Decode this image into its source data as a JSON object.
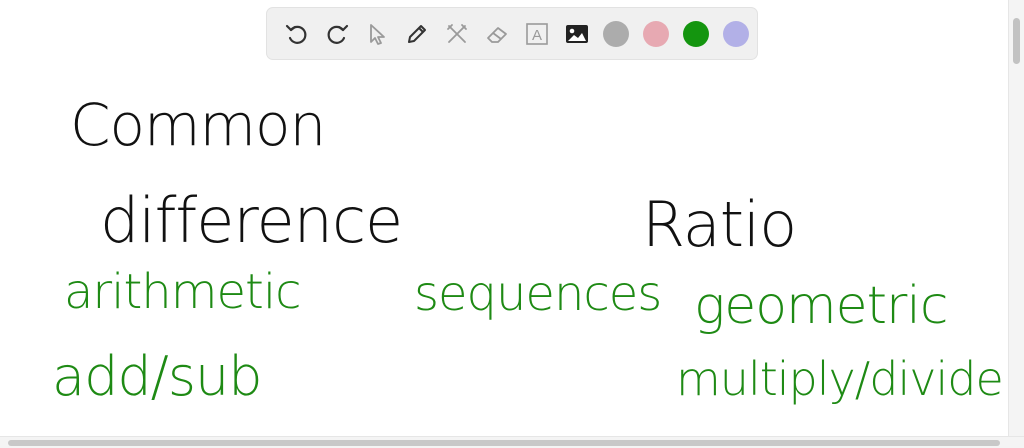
{
  "toolbar": {
    "tools": [
      {
        "icon": "undo-icon"
      },
      {
        "icon": "redo-icon"
      },
      {
        "icon": "pointer-icon"
      },
      {
        "icon": "pencil-icon"
      },
      {
        "icon": "tools-icon"
      },
      {
        "icon": "eraser-icon"
      },
      {
        "icon": "text-icon",
        "label": "A"
      },
      {
        "icon": "image-icon"
      }
    ],
    "colors": [
      "#acacac",
      "#e7a9b2",
      "#14950f",
      "#b2b0e7"
    ],
    "selected_color": "#14950f"
  },
  "board": {
    "common": "Common",
    "difference": "difference",
    "ratio": "Ratio",
    "arithmetic": "arithmetic",
    "sequences": "sequences",
    "geometric": "geometric",
    "add_sub": "add/sub",
    "multiply_divide": "multiply/divide"
  }
}
